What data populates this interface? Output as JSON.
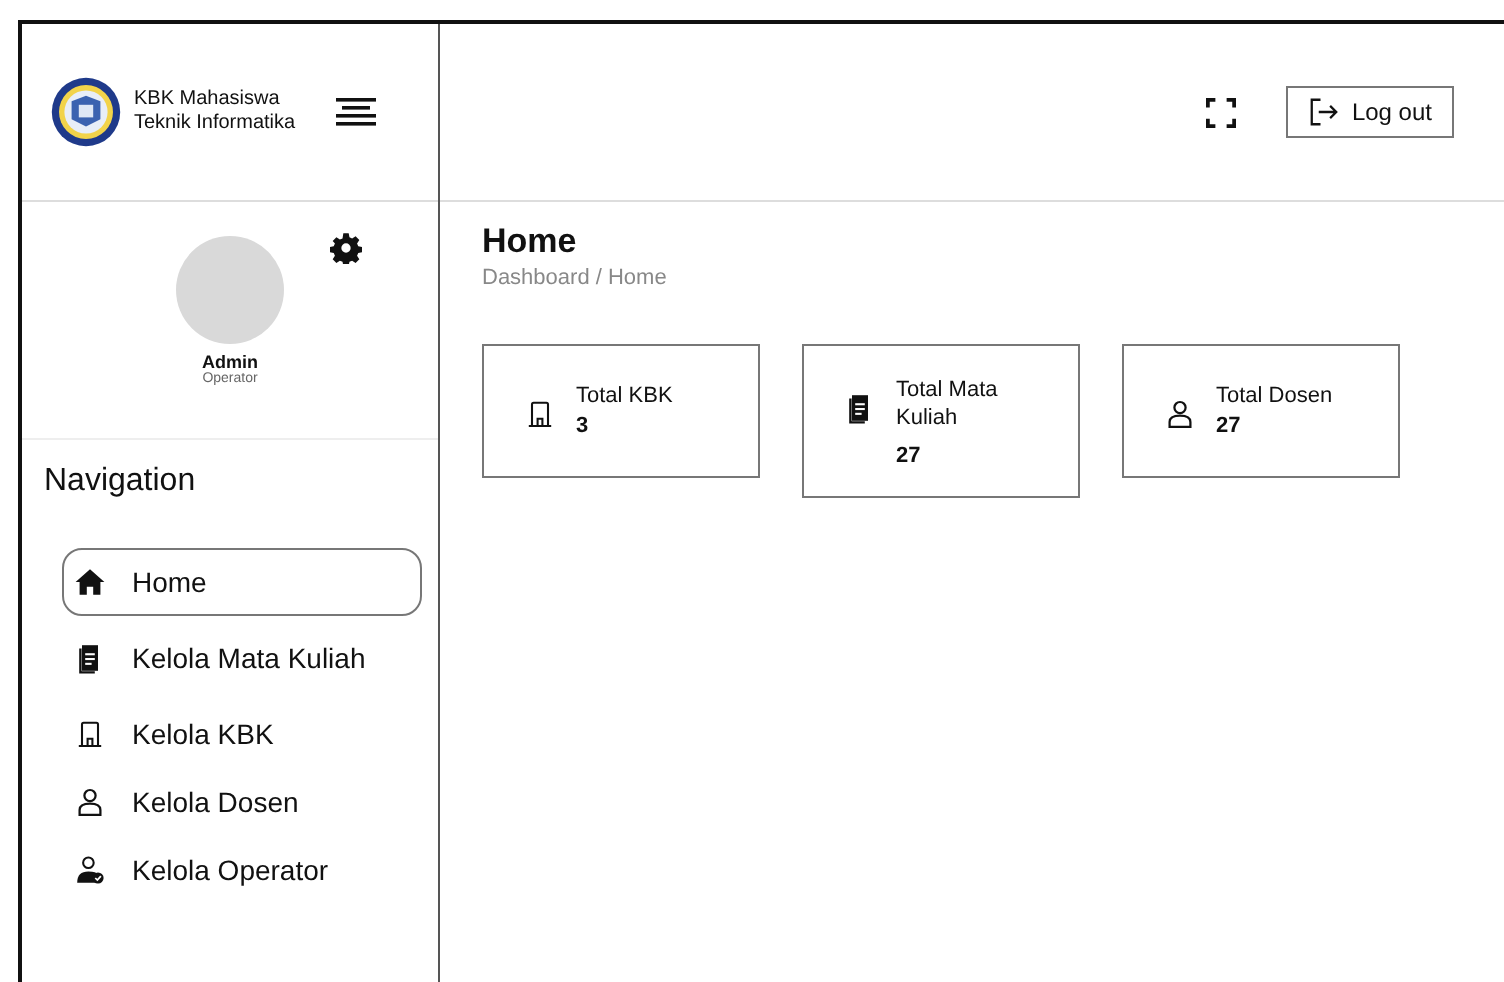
{
  "brand": {
    "line1": "KBK Mahasiswa",
    "line2": "Teknik Informatika"
  },
  "profile": {
    "name": "Admin",
    "role": "Operator"
  },
  "navigation": {
    "title": "Navigation",
    "items": [
      {
        "label": "Home",
        "kind": "home",
        "selected": true
      },
      {
        "label": "Kelola Mata Kuliah",
        "kind": "document",
        "selected": false
      },
      {
        "label": "Kelola KBK",
        "kind": "building",
        "selected": false
      },
      {
        "label": "Kelola Dosen",
        "kind": "person",
        "selected": false
      },
      {
        "label": "Kelola Operator",
        "kind": "operator",
        "selected": false
      }
    ]
  },
  "header": {
    "logout_label": "Log out"
  },
  "page": {
    "title": "Home",
    "breadcrumb": "Dashboard / Home"
  },
  "stats": [
    {
      "label": "Total KBK",
      "value": "3",
      "kind": "building"
    },
    {
      "label": "Total Mata Kuliah",
      "value": "27",
      "kind": "document"
    },
    {
      "label": "Total Dosen",
      "value": "27",
      "kind": "person"
    }
  ]
}
